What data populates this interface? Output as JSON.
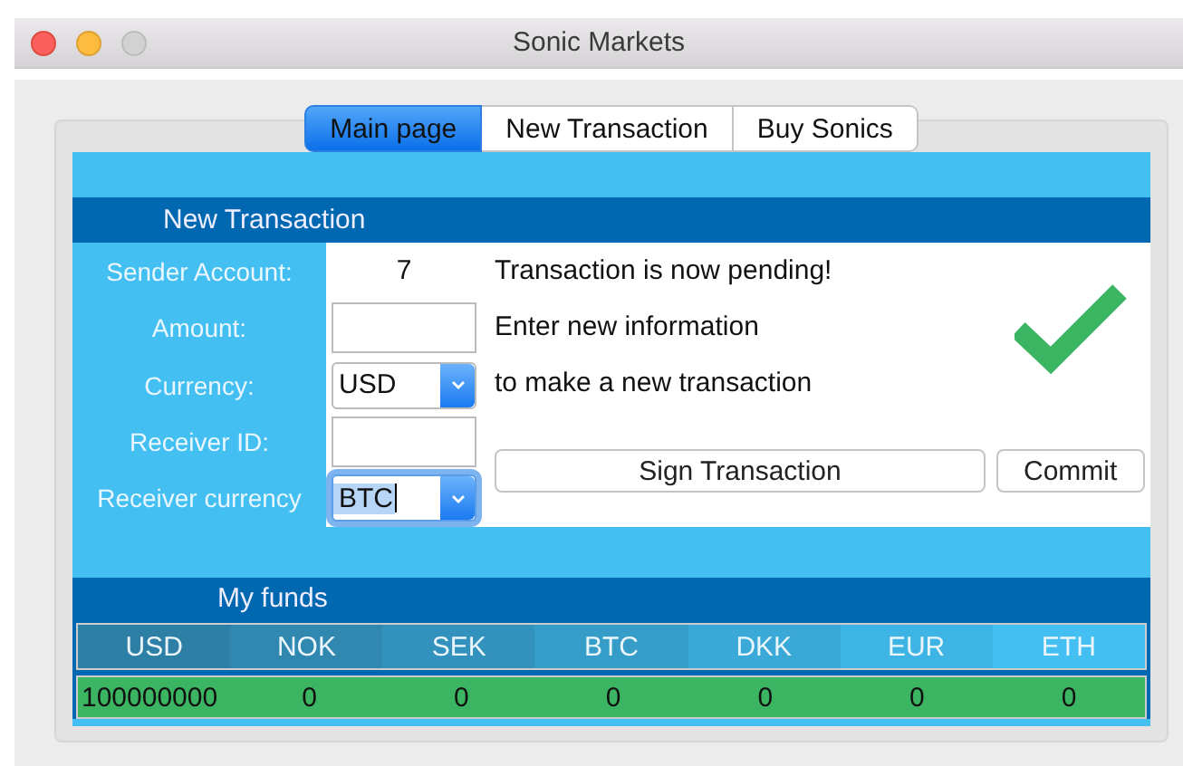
{
  "window": {
    "title": "Sonic Markets"
  },
  "tabs": [
    {
      "label": "Main page",
      "selected": true
    },
    {
      "label": "New Transaction",
      "selected": false
    },
    {
      "label": "Buy Sonics",
      "selected": false
    }
  ],
  "transaction": {
    "title": "New Transaction",
    "fields": [
      {
        "label": "Sender Account:",
        "kind": "value",
        "value": "7"
      },
      {
        "label": "Amount:",
        "kind": "input"
      },
      {
        "label": "Currency:",
        "kind": "select",
        "value": "USD",
        "focused": false
      },
      {
        "label": "Receiver ID:",
        "kind": "input"
      },
      {
        "label": "Receiver currency",
        "kind": "select",
        "value": "BTC",
        "focused": true
      }
    ],
    "messages": [
      "Transaction is now pending!",
      "Enter new information",
      "to make a new transaction"
    ],
    "success": true,
    "buttons": [
      "Sign Transaction",
      "Commit"
    ]
  },
  "funds": {
    "title": "My funds",
    "columns": [
      "USD",
      "NOK",
      "SEK",
      "BTC",
      "DKK",
      "EUR",
      "ETH"
    ],
    "rows": [
      [
        "100000000",
        "0",
        "0",
        "0",
        "0",
        "0",
        "0"
      ]
    ]
  }
}
